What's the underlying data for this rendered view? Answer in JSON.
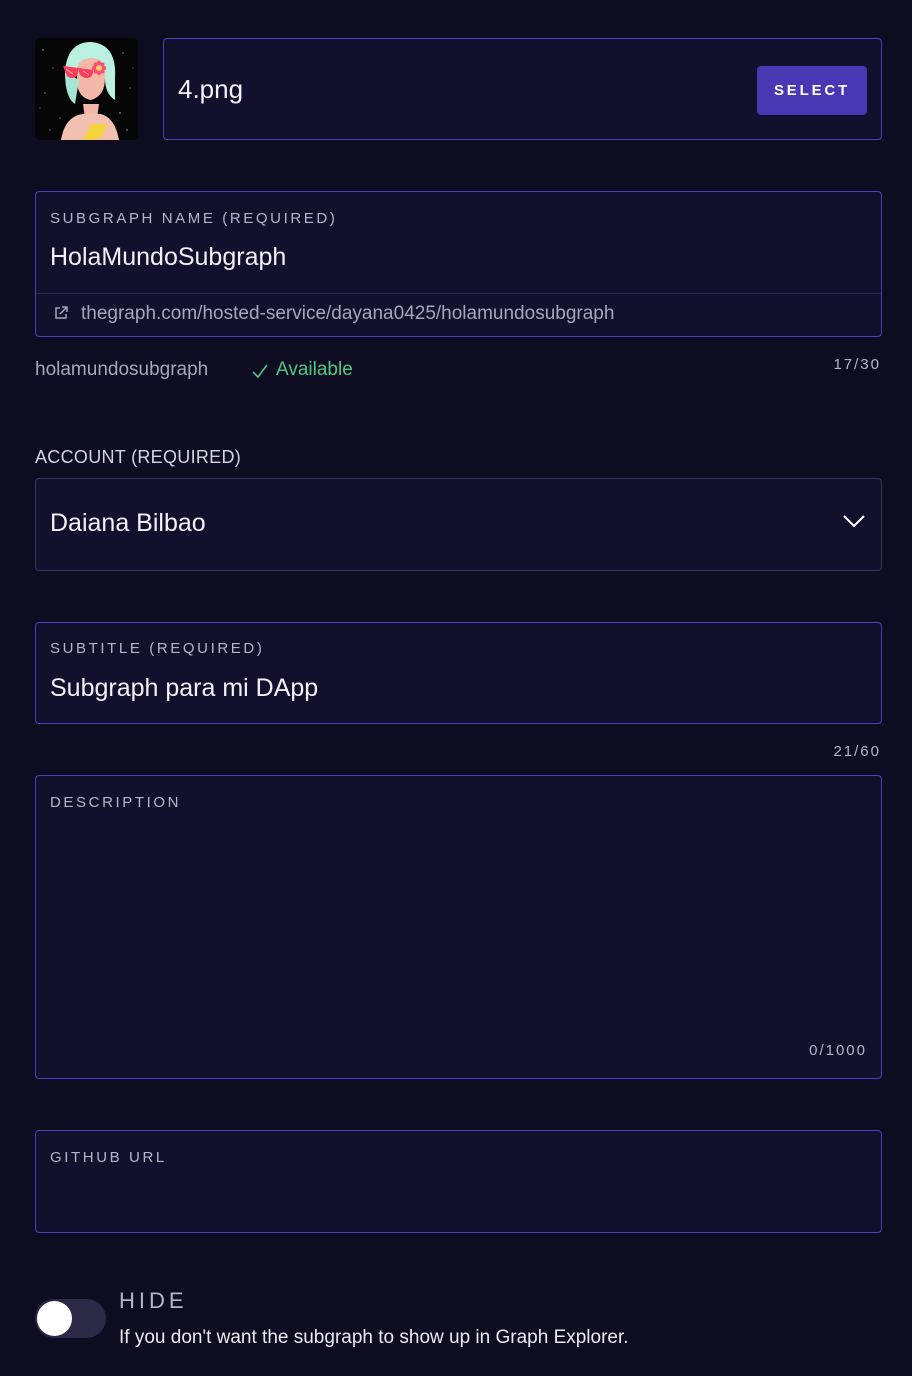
{
  "image_upload": {
    "file_name": "4.png",
    "select_label": "SELECT"
  },
  "subgraph_name": {
    "label": "SUBGRAPH NAME (REQUIRED)",
    "value": "HolaMundoSubgraph",
    "url": "thegraph.com/hosted-service/dayana0425/holamundosubgraph",
    "slug": "holamundosubgraph",
    "status": "Available",
    "count": "17/30"
  },
  "account": {
    "label": "ACCOUNT (REQUIRED)",
    "value": "Daiana Bilbao"
  },
  "subtitle": {
    "label": "SUBTITLE (REQUIRED)",
    "value": "Subgraph para mi DApp",
    "count": "21/60"
  },
  "description": {
    "label": "DESCRIPTION",
    "value": "",
    "count": "0/1000"
  },
  "github": {
    "label": "GITHUB URL",
    "value": ""
  },
  "hide": {
    "title": "HIDE",
    "description": "If you don't want the subgraph to show up in Graph Explorer.",
    "enabled": false
  },
  "colors": {
    "background": "#0e0c20",
    "field_border": "#4c3dbf",
    "button": "#4a37b4",
    "success": "#4bca81"
  },
  "icons": {
    "link": "external-link-icon",
    "status": "check-icon",
    "dropdown": "chevron-down-icon"
  }
}
